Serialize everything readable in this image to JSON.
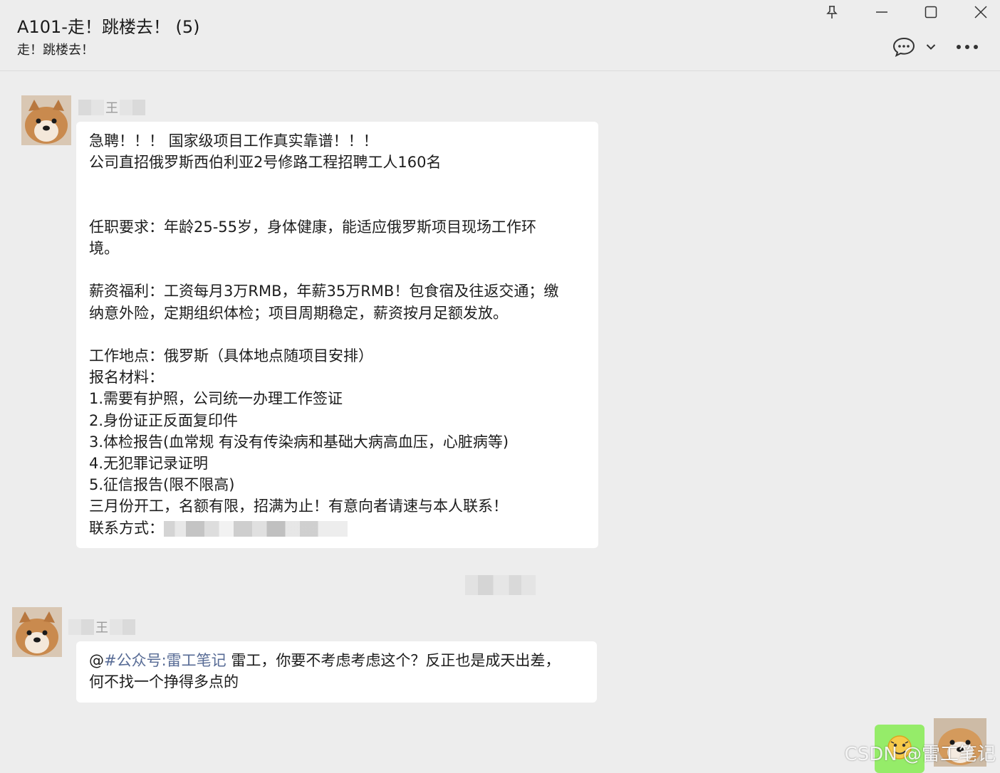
{
  "window": {
    "title": "A101-走！跳楼去！ (5)",
    "subtitle": "走！跳楼去！",
    "controls": [
      "pin-icon",
      "minimize-icon",
      "maximize-icon",
      "close-icon"
    ],
    "toolbar_icons": [
      "chat-bubble-icon",
      "chevron-down-icon",
      "more-icon"
    ]
  },
  "messages": [
    {
      "sender_name_visible": "王",
      "lines": [
        "急聘！！！ 国家级项目工作真实靠谱！！！",
        "公司直招俄罗斯西伯利亚2号修路工程招聘工人160名",
        "",
        "",
        "任职要求：年龄25-55岁，身体健康，能适应俄罗斯项目现场工作环",
        "境。",
        "",
        "薪资福利：工资每月3万RMB，年薪35万RMB！包食宿及往返交通；缴",
        "纳意外险，定期组织体检；项目周期稳定，薪资按月足额发放。",
        "",
        "工作地点：俄罗斯（具体地点随项目安排）",
        "报名材料：",
        "1.需要有护照，公司统一办理工作签证",
        "2.身份证正反面复印件",
        "3.体检报告(血常规 有没有传染病和基础大病高血压，心脏病等)",
        "4.无犯罪记录证明",
        "5.征信报告(限不限高)",
        "三月份开工，名额有限，招满为止！有意向者请速与本人联系！"
      ],
      "contact_label": "联系方式："
    },
    {
      "sender_name_visible": "王",
      "at_sign": "@",
      "mention": "#公众号:雷工笔记",
      "text_line1": " 雷工，你要不考虑考虑这个？反正也是成天出差，",
      "text_line2": "何不找一个挣得多点的"
    }
  ],
  "my_message": {
    "content_icon": "emoji-icon"
  },
  "watermark": "CSDN @雷工笔记",
  "colors": {
    "background": "#ededed",
    "bubble_other": "#ffffff",
    "bubble_self": "#95ec69",
    "mention": "#576b95"
  }
}
